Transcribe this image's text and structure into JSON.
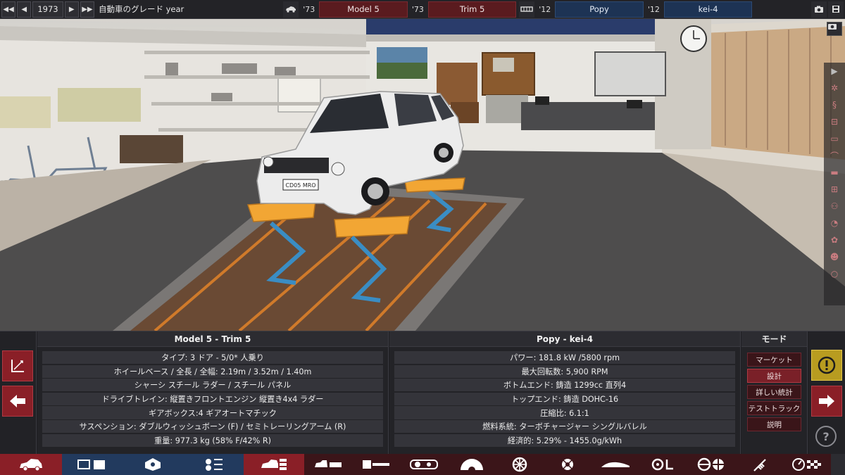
{
  "topbar": {
    "year": "1973",
    "year_label": "自動車のグレード year",
    "car_year": "'73",
    "model": "Model 5",
    "trim_year": "'73",
    "trim": "Trim 5",
    "engine_year": "'12",
    "engine_family": "Popy",
    "variant_year": "'12",
    "variant": "kei-4"
  },
  "car_panel": {
    "title": "Model 5 - Trim 5",
    "rows": [
      "タイプ: 3 ドア - 5/0* 人乗り",
      "ホイールベース / 全長 / 全幅: 2.19m / 3.52m / 1.40m",
      "シャーシ スチール ラダー / スチール パネル",
      "ドライブトレイン: 縦置きフロントエンジン 縦置き4x4 ラダー",
      "ギアボックス:4 ギアオートマチック",
      "サスペンション: ダブルウィッシュボーン (F) / セミトレーリングアーム (R)",
      "重量: 977.3 kg (58% F/42% R)"
    ]
  },
  "engine_panel": {
    "title": "Popy - kei-4",
    "rows": [
      "パワー: 181.8 kW /5800 rpm",
      "最大回転数: 5,900 RPM",
      "ボトムエンド: 鋳造 1299cc 直列4",
      "トップエンド: 鋳造 DOHC-16",
      "圧縮比: 6.1:1",
      "燃料系統: ターボチャージャー シングルバレル",
      "経済的: 5.29% - 1455.0g/kWh"
    ]
  },
  "mode_panel": {
    "title": "モード",
    "buttons": [
      "マーケット",
      "設計",
      "詳しい統計",
      "テストトラック",
      "説明"
    ],
    "active": "設計"
  },
  "scene": {
    "license_plate": "CD05 MRO"
  },
  "colors": {
    "accent_red": "#8a1f27",
    "accent_blue": "#1d3354",
    "warning_yellow": "#b89c20"
  },
  "icons": {
    "nav": [
      "skip-back-icon",
      "prev-icon",
      "next-icon",
      "skip-forward-icon",
      "car-icon",
      "engine-icon",
      "screenshot-icon",
      "save-icon"
    ],
    "steps": [
      "car-body-icon",
      "engine-block-icon",
      "cylinder-icon",
      "valvetrain-icon",
      "chassis-icon",
      "body-panels-icon",
      "drivetrain-icon",
      "headlights-icon",
      "gearbox-icon",
      "wheel-icon",
      "brakes-icon",
      "aero-icon",
      "interior-icon",
      "safety-icon",
      "suspension-icon",
      "testing-icon",
      "finish-check-icon"
    ]
  }
}
